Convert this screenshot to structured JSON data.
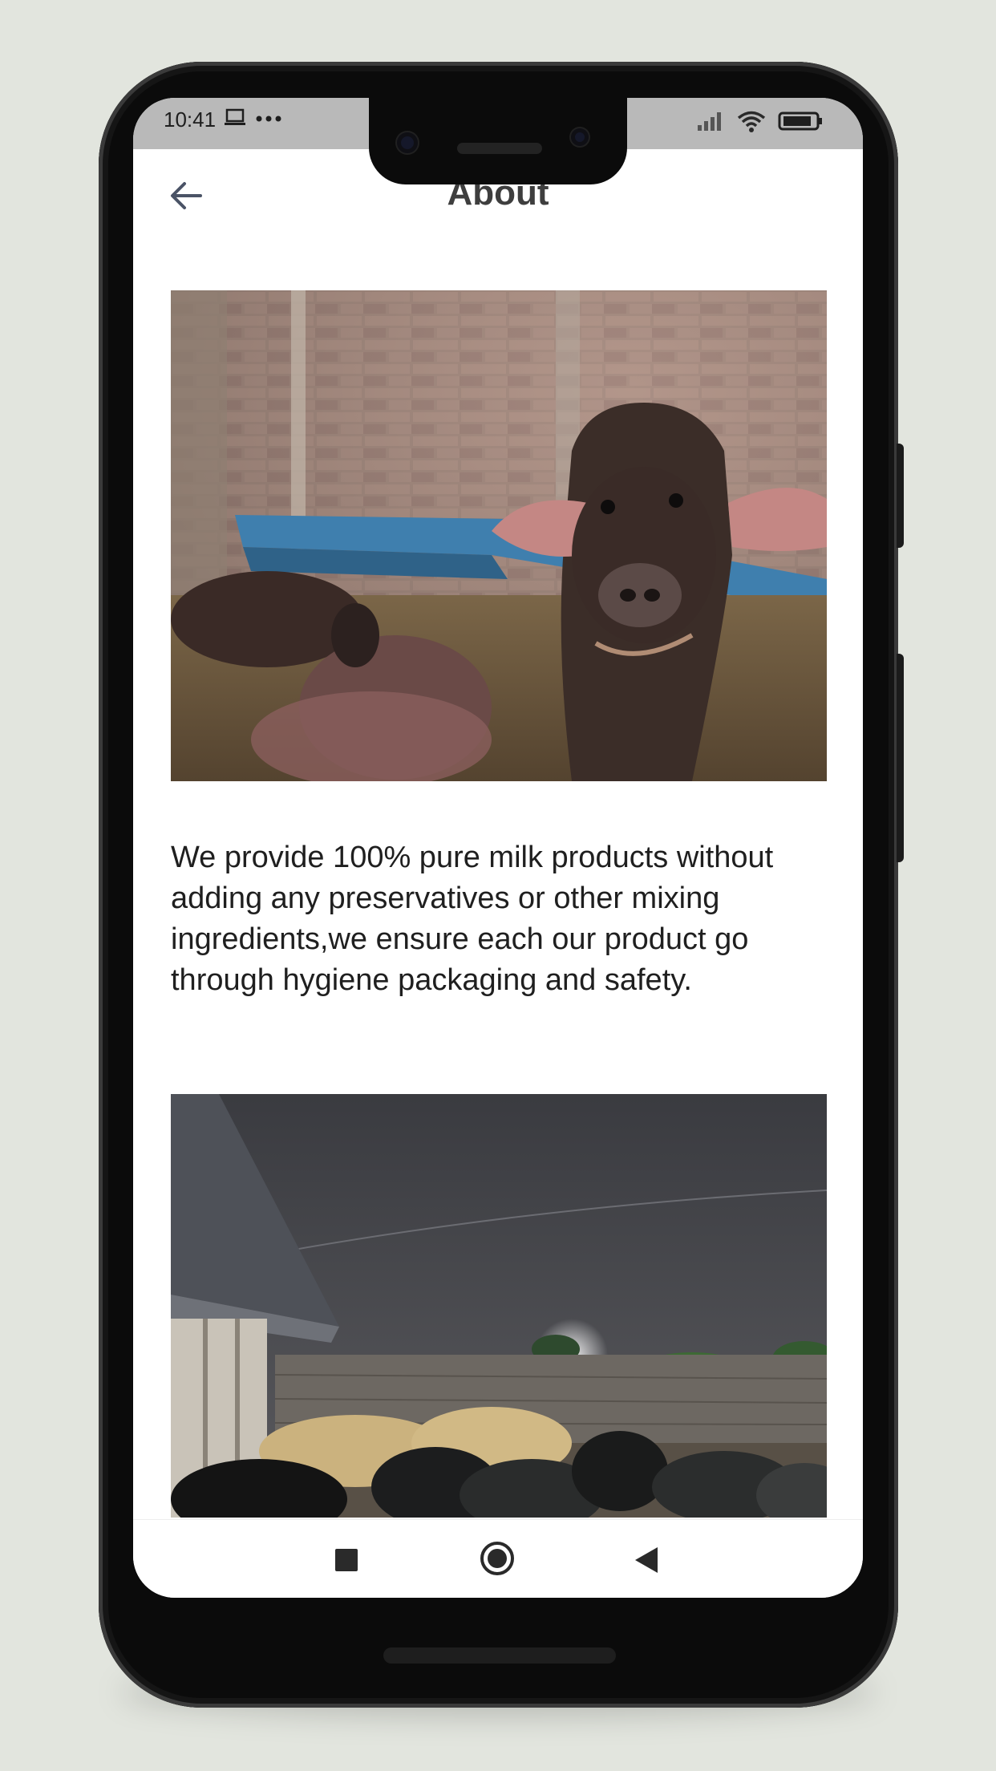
{
  "status_bar": {
    "time": "10:41",
    "icons": [
      "laptop-icon",
      "more-dots-icon",
      "signal-icon",
      "wifi-icon",
      "battery-icon"
    ]
  },
  "header": {
    "title": "About",
    "back_icon": "arrow-left-icon"
  },
  "content": {
    "description": "We provide 100% pure milk products without adding any preservatives or other mixing ingredients,we ensure each our product go through hygiene packaging and safety."
  },
  "navigation_bar": {
    "buttons": [
      "recent-apps-button",
      "home-button",
      "back-button"
    ]
  },
  "colors": {
    "background": "#e2e5de",
    "status_bar": "#b9b9b9",
    "title_text": "#3e3e3e",
    "body_text": "#1f1f1f"
  }
}
